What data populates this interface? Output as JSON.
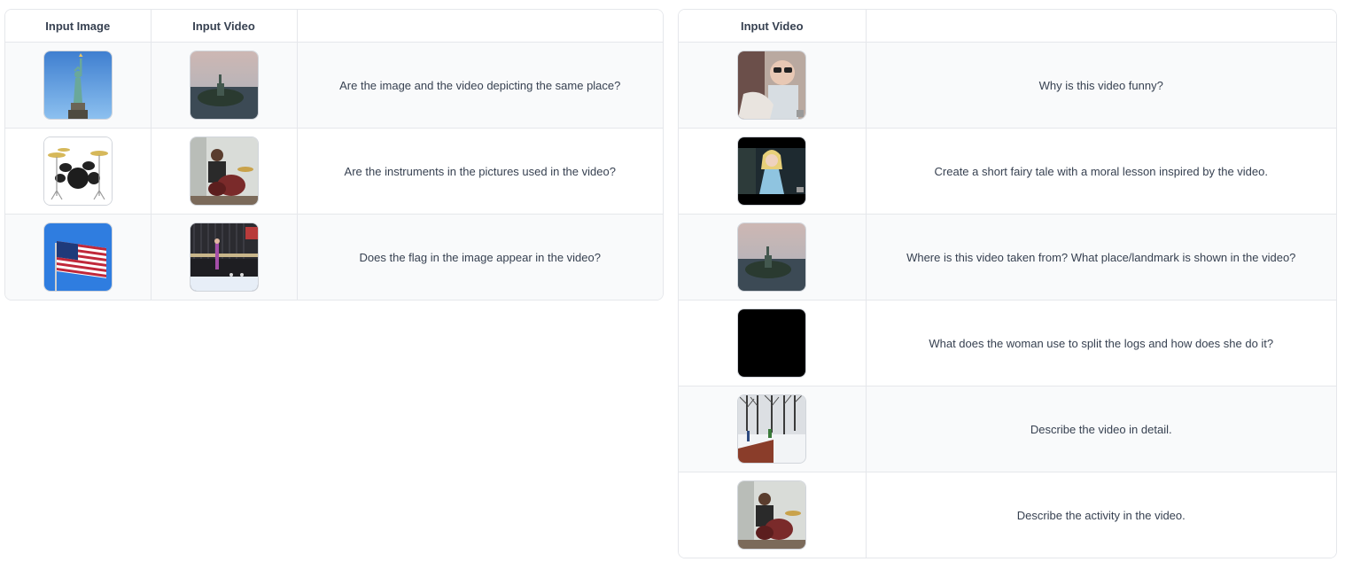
{
  "left_table": {
    "headers": [
      "Input Image",
      "Input Video",
      ""
    ],
    "rows": [
      {
        "image_icon": "statue-of-liberty-image",
        "video_icon": "statue-of-liberty-aerial-video",
        "question": "Are the image and the video depicting the same place?"
      },
      {
        "image_icon": "drum-kit-image",
        "video_icon": "drummer-video",
        "question": "Are the instruments in the pictures used in the video?"
      },
      {
        "image_icon": "american-flag-image",
        "video_icon": "gymnastics-beam-video",
        "question": "Does the flag in the image appear in the video?"
      }
    ]
  },
  "right_table": {
    "headers": [
      "Input Video",
      ""
    ],
    "rows": [
      {
        "video_icon": "child-with-glasses-video",
        "question": "Why is this video funny?"
      },
      {
        "video_icon": "princess-in-blue-dress-video",
        "question": "Create a short fairy tale with a moral lesson inspired by the video."
      },
      {
        "video_icon": "statue-of-liberty-aerial-video",
        "question": "Where is this video taken from? What place/landmark is shown in the video?"
      },
      {
        "video_icon": "black-frame-video",
        "question": "What does the woman use to split the logs and how does she do it?"
      },
      {
        "video_icon": "snowy-park-video",
        "question": "Describe the video in detail."
      },
      {
        "video_icon": "drummer-video",
        "question": "Describe the activity in the video."
      }
    ]
  }
}
